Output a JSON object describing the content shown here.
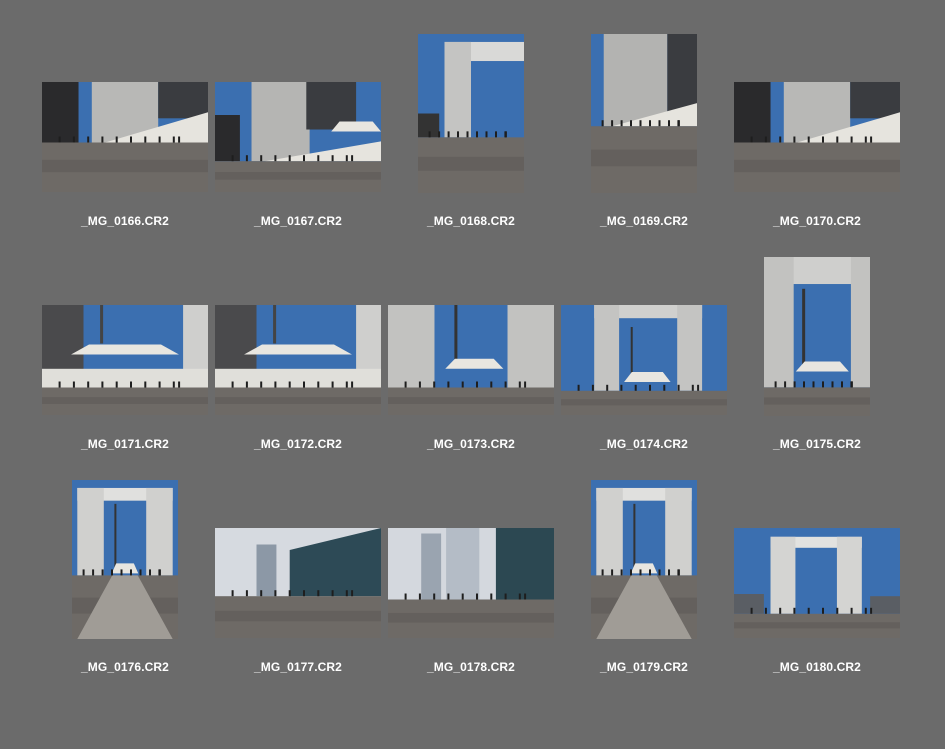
{
  "photos": [
    {
      "filename": "_MG_0166.CR2",
      "orientation": "landscape",
      "scene": "arch-side-stairs"
    },
    {
      "filename": "_MG_0167.CR2",
      "orientation": "landscape",
      "scene": "arch-side-canopy"
    },
    {
      "filename": "_MG_0168.CR2",
      "orientation": "portrait",
      "scene": "arch-corner"
    },
    {
      "filename": "_MG_0169.CR2",
      "orientation": "portrait",
      "scene": "arch-wall-stairs"
    },
    {
      "filename": "_MG_0170.CR2",
      "orientation": "landscape",
      "scene": "arch-side-stairs"
    },
    {
      "filename": "_MG_0171.CR2",
      "orientation": "landscape",
      "scene": "canopy-close"
    },
    {
      "filename": "_MG_0172.CR2",
      "orientation": "landscape",
      "scene": "canopy-close"
    },
    {
      "filename": "_MG_0173.CR2",
      "orientation": "landscape",
      "scene": "arch-inside"
    },
    {
      "filename": "_MG_0174.CR2",
      "orientation": "landscape",
      "scene": "arch-front"
    },
    {
      "filename": "_MG_0175.CR2",
      "orientation": "portrait",
      "scene": "arch-inside-tall"
    },
    {
      "filename": "_MG_0176.CR2",
      "orientation": "portrait",
      "scene": "arch-front-walkway"
    },
    {
      "filename": "_MG_0177.CR2",
      "orientation": "landscape",
      "scene": "towers-glass"
    },
    {
      "filename": "_MG_0178.CR2",
      "orientation": "landscape",
      "scene": "towers-plaza"
    },
    {
      "filename": "_MG_0179.CR2",
      "orientation": "portrait",
      "scene": "arch-front-walkway"
    },
    {
      "filename": "_MG_0180.CR2",
      "orientation": "landscape",
      "scene": "arch-distant"
    }
  ],
  "colors": {
    "background": "#6b6b6b",
    "caption": "#ffffff"
  }
}
